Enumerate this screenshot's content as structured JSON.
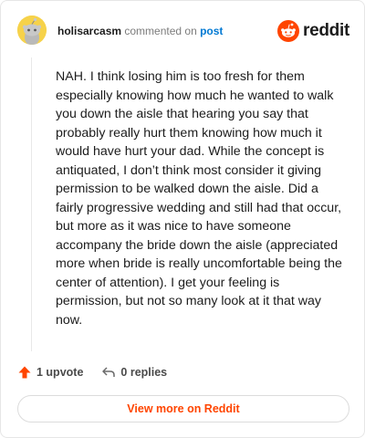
{
  "header": {
    "username": "holisarcasm",
    "action_text": " commented on ",
    "post_link": "post",
    "brand": "reddit"
  },
  "comment": {
    "body": "NAH. I think losing him is too fresh for them especially knowing how much he wanted to walk you down the aisle that hearing you say that probably really hurt them knowing how much it would have hurt your dad. While the concept is antiquated, I don’t think most consider it giving permission to be walked down the aisle. Did a fairly progressive wedding and still had that occur, but more as it was nice to have someone accompany the bride down the aisle (appreciated more when bride is really uncomfortable being the center of attention). I get your feeling is permission, but not so many look at it that way now."
  },
  "actions": {
    "upvote_label": "1 upvote",
    "replies_label": "0 replies"
  },
  "footer": {
    "view_more_label": "View more on Reddit"
  },
  "colors": {
    "brand": "#ff4500",
    "link": "#0079d3",
    "avatar_bg": "#f6d24a"
  },
  "icons": {
    "avatar": "snoo-avatar-icon",
    "logo": "reddit-logo-icon",
    "upvote": "upvote-arrow-icon",
    "reply": "reply-arrow-icon"
  }
}
